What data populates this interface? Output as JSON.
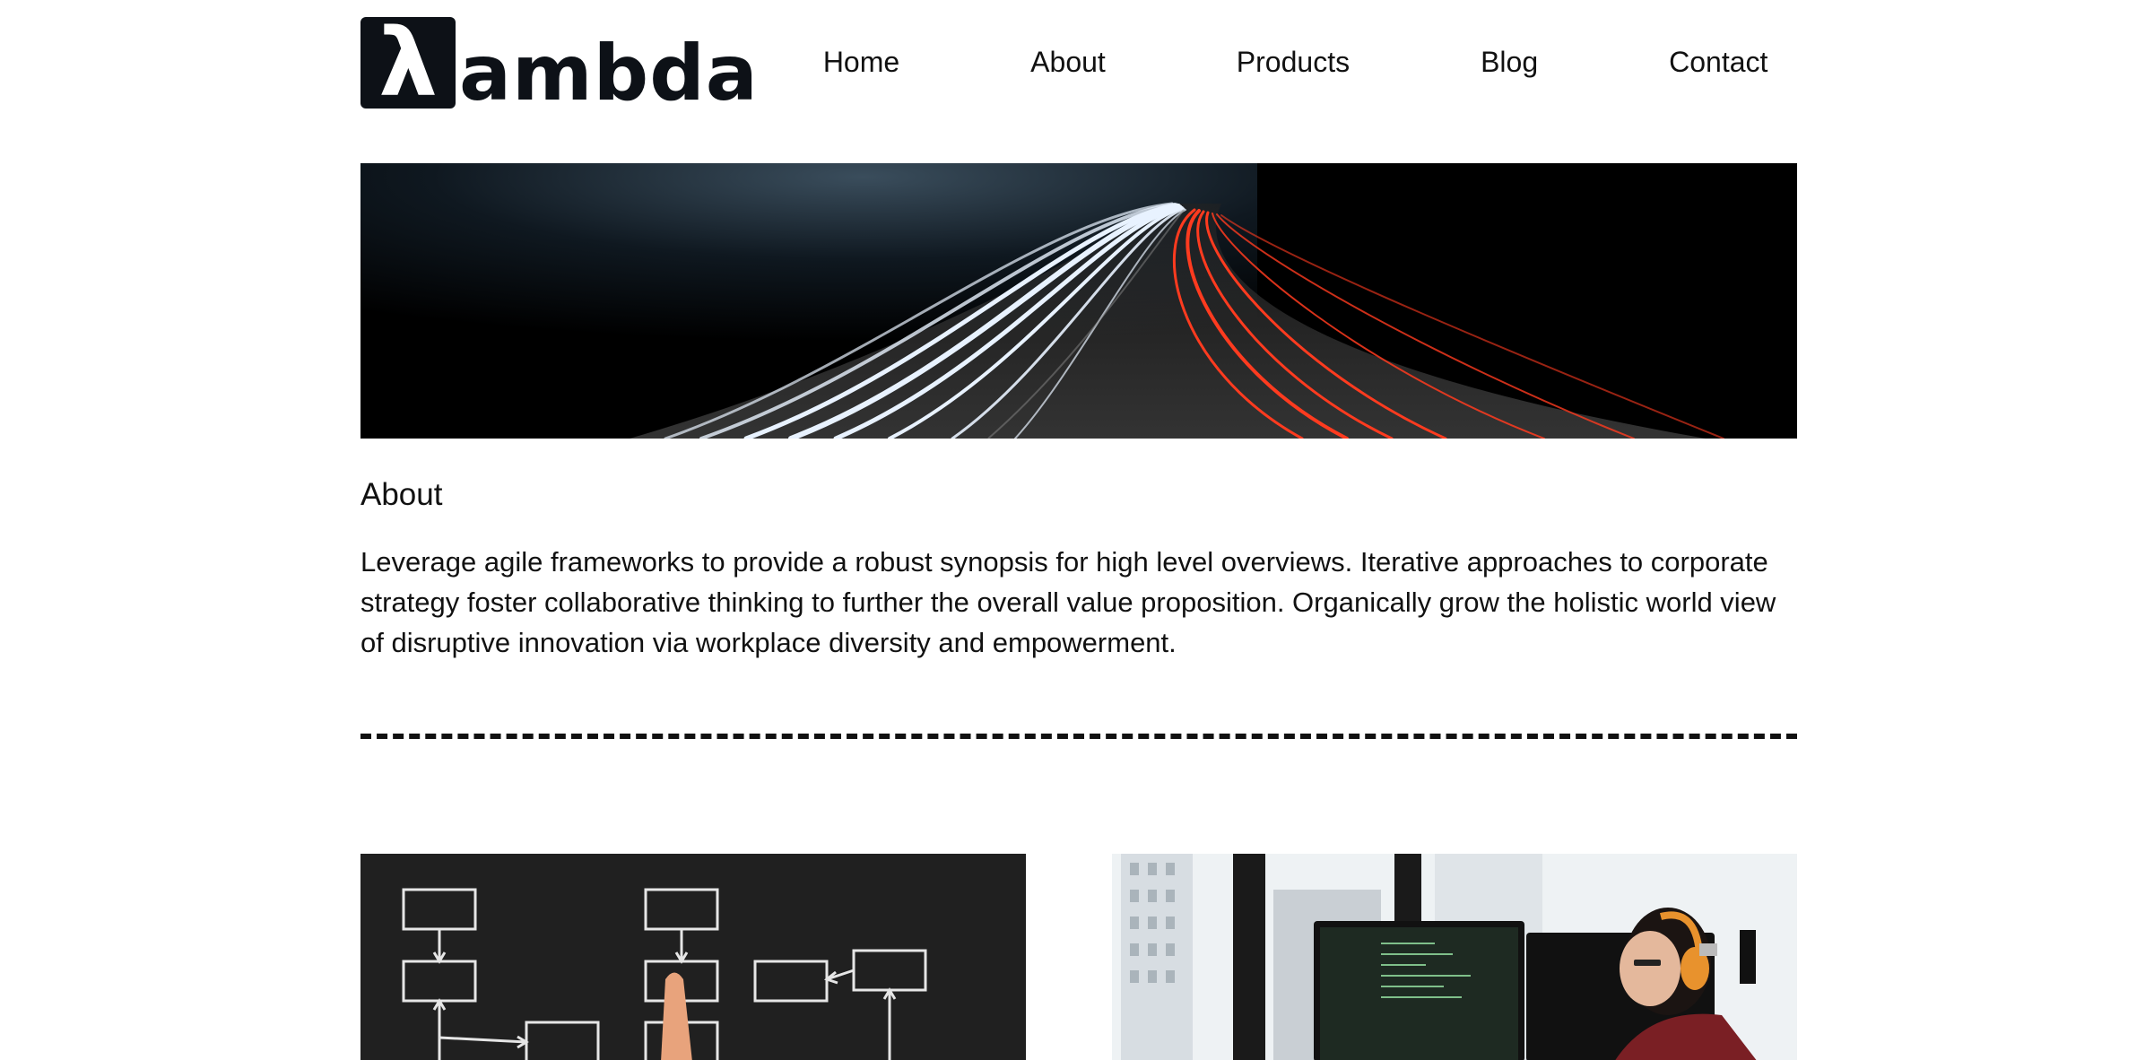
{
  "header": {
    "logo": {
      "badge_glyph": "λ",
      "text": "ambda",
      "colors": {
        "badge": "#0d1117",
        "text": "#0d1117"
      }
    },
    "nav": [
      {
        "label": "Home"
      },
      {
        "label": "About"
      },
      {
        "label": "Products"
      },
      {
        "label": "Blog"
      },
      {
        "label": "Contact"
      }
    ]
  },
  "hero": {
    "image": "long-exposure-highway-light-trails",
    "colors": {
      "background": "#000000",
      "trail_white": "#e8f2ff",
      "trail_red": "#ff3b1f"
    }
  },
  "about": {
    "title": "About",
    "body": "Leverage agile frameworks to provide a robust synopsis for high level overviews. Iterative approaches to corporate strategy foster collaborative thinking to further the overall value proposition. Organically grow the holistic world view of disruptive innovation via workplace diversity and empowerment."
  },
  "divider": {
    "style": "dashed",
    "color": "#111111"
  },
  "cards": [
    {
      "image": "chalkboard-flowchart-with-hand"
    },
    {
      "image": "developer-with-orange-headphones-at-monitors"
    }
  ]
}
